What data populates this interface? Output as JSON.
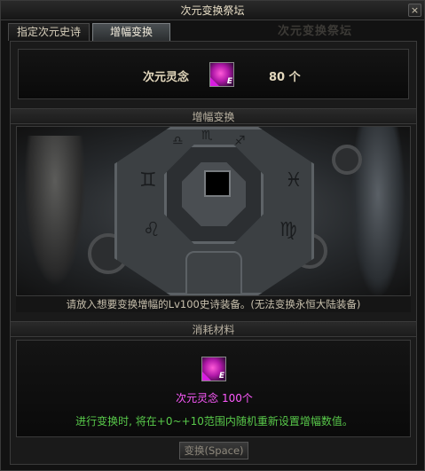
{
  "window": {
    "title": "次元变换祭坛",
    "close_glyph": "×"
  },
  "tabs": [
    {
      "label": "指定次元史诗",
      "active": false
    },
    {
      "label": "增幅变换",
      "active": true
    }
  ],
  "background_title": "次元变换祭坛",
  "soul": {
    "label": "次元灵念",
    "count": "80 个",
    "icon": "dimension-soul-item-icon",
    "icon_badge": "E"
  },
  "amplify": {
    "header": "增幅变换",
    "hint": "请放入想要变换增幅的Lv100史诗装备。(无法变换永恒大陆装备)",
    "runes": [
      "♊",
      "♓",
      "♌",
      "♍",
      "♎",
      "♏",
      "♐"
    ]
  },
  "materials": {
    "header": "消耗材料",
    "item_name": "次元灵念 100个",
    "icon_badge": "E",
    "note": "进行变换时, 将在+0~+10范围内随机重新设置增幅数值。"
  },
  "exchange_button": {
    "label": "变换(Space)"
  },
  "colors": {
    "material_name": "#ff5aff",
    "note": "#58c94a",
    "accent_text": "#e3d8bd"
  }
}
